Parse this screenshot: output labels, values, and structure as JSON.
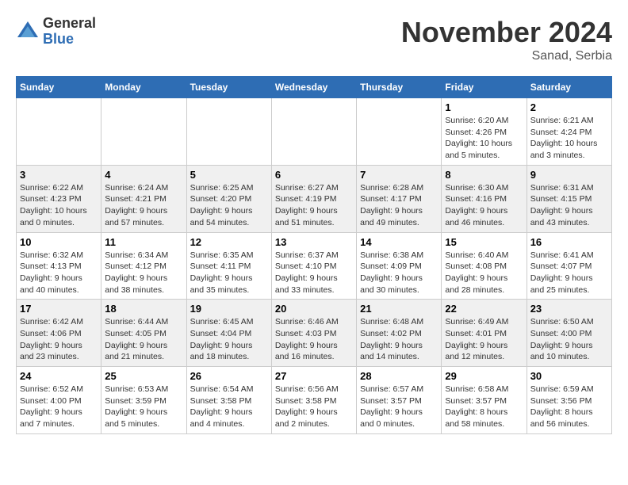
{
  "header": {
    "logo_general": "General",
    "logo_blue": "Blue",
    "month_year": "November 2024",
    "location": "Sanad, Serbia"
  },
  "weekdays": [
    "Sunday",
    "Monday",
    "Tuesday",
    "Wednesday",
    "Thursday",
    "Friday",
    "Saturday"
  ],
  "weeks": [
    [
      {
        "day": "",
        "info": ""
      },
      {
        "day": "",
        "info": ""
      },
      {
        "day": "",
        "info": ""
      },
      {
        "day": "",
        "info": ""
      },
      {
        "day": "",
        "info": ""
      },
      {
        "day": "1",
        "info": "Sunrise: 6:20 AM\nSunset: 4:26 PM\nDaylight: 10 hours\nand 5 minutes."
      },
      {
        "day": "2",
        "info": "Sunrise: 6:21 AM\nSunset: 4:24 PM\nDaylight: 10 hours\nand 3 minutes."
      }
    ],
    [
      {
        "day": "3",
        "info": "Sunrise: 6:22 AM\nSunset: 4:23 PM\nDaylight: 10 hours\nand 0 minutes."
      },
      {
        "day": "4",
        "info": "Sunrise: 6:24 AM\nSunset: 4:21 PM\nDaylight: 9 hours\nand 57 minutes."
      },
      {
        "day": "5",
        "info": "Sunrise: 6:25 AM\nSunset: 4:20 PM\nDaylight: 9 hours\nand 54 minutes."
      },
      {
        "day": "6",
        "info": "Sunrise: 6:27 AM\nSunset: 4:19 PM\nDaylight: 9 hours\nand 51 minutes."
      },
      {
        "day": "7",
        "info": "Sunrise: 6:28 AM\nSunset: 4:17 PM\nDaylight: 9 hours\nand 49 minutes."
      },
      {
        "day": "8",
        "info": "Sunrise: 6:30 AM\nSunset: 4:16 PM\nDaylight: 9 hours\nand 46 minutes."
      },
      {
        "day": "9",
        "info": "Sunrise: 6:31 AM\nSunset: 4:15 PM\nDaylight: 9 hours\nand 43 minutes."
      }
    ],
    [
      {
        "day": "10",
        "info": "Sunrise: 6:32 AM\nSunset: 4:13 PM\nDaylight: 9 hours\nand 40 minutes."
      },
      {
        "day": "11",
        "info": "Sunrise: 6:34 AM\nSunset: 4:12 PM\nDaylight: 9 hours\nand 38 minutes."
      },
      {
        "day": "12",
        "info": "Sunrise: 6:35 AM\nSunset: 4:11 PM\nDaylight: 9 hours\nand 35 minutes."
      },
      {
        "day": "13",
        "info": "Sunrise: 6:37 AM\nSunset: 4:10 PM\nDaylight: 9 hours\nand 33 minutes."
      },
      {
        "day": "14",
        "info": "Sunrise: 6:38 AM\nSunset: 4:09 PM\nDaylight: 9 hours\nand 30 minutes."
      },
      {
        "day": "15",
        "info": "Sunrise: 6:40 AM\nSunset: 4:08 PM\nDaylight: 9 hours\nand 28 minutes."
      },
      {
        "day": "16",
        "info": "Sunrise: 6:41 AM\nSunset: 4:07 PM\nDaylight: 9 hours\nand 25 minutes."
      }
    ],
    [
      {
        "day": "17",
        "info": "Sunrise: 6:42 AM\nSunset: 4:06 PM\nDaylight: 9 hours\nand 23 minutes."
      },
      {
        "day": "18",
        "info": "Sunrise: 6:44 AM\nSunset: 4:05 PM\nDaylight: 9 hours\nand 21 minutes."
      },
      {
        "day": "19",
        "info": "Sunrise: 6:45 AM\nSunset: 4:04 PM\nDaylight: 9 hours\nand 18 minutes."
      },
      {
        "day": "20",
        "info": "Sunrise: 6:46 AM\nSunset: 4:03 PM\nDaylight: 9 hours\nand 16 minutes."
      },
      {
        "day": "21",
        "info": "Sunrise: 6:48 AM\nSunset: 4:02 PM\nDaylight: 9 hours\nand 14 minutes."
      },
      {
        "day": "22",
        "info": "Sunrise: 6:49 AM\nSunset: 4:01 PM\nDaylight: 9 hours\nand 12 minutes."
      },
      {
        "day": "23",
        "info": "Sunrise: 6:50 AM\nSunset: 4:00 PM\nDaylight: 9 hours\nand 10 minutes."
      }
    ],
    [
      {
        "day": "24",
        "info": "Sunrise: 6:52 AM\nSunset: 4:00 PM\nDaylight: 9 hours\nand 7 minutes."
      },
      {
        "day": "25",
        "info": "Sunrise: 6:53 AM\nSunset: 3:59 PM\nDaylight: 9 hours\nand 5 minutes."
      },
      {
        "day": "26",
        "info": "Sunrise: 6:54 AM\nSunset: 3:58 PM\nDaylight: 9 hours\nand 4 minutes."
      },
      {
        "day": "27",
        "info": "Sunrise: 6:56 AM\nSunset: 3:58 PM\nDaylight: 9 hours\nand 2 minutes."
      },
      {
        "day": "28",
        "info": "Sunrise: 6:57 AM\nSunset: 3:57 PM\nDaylight: 9 hours\nand 0 minutes."
      },
      {
        "day": "29",
        "info": "Sunrise: 6:58 AM\nSunset: 3:57 PM\nDaylight: 8 hours\nand 58 minutes."
      },
      {
        "day": "30",
        "info": "Sunrise: 6:59 AM\nSunset: 3:56 PM\nDaylight: 8 hours\nand 56 minutes."
      }
    ]
  ]
}
